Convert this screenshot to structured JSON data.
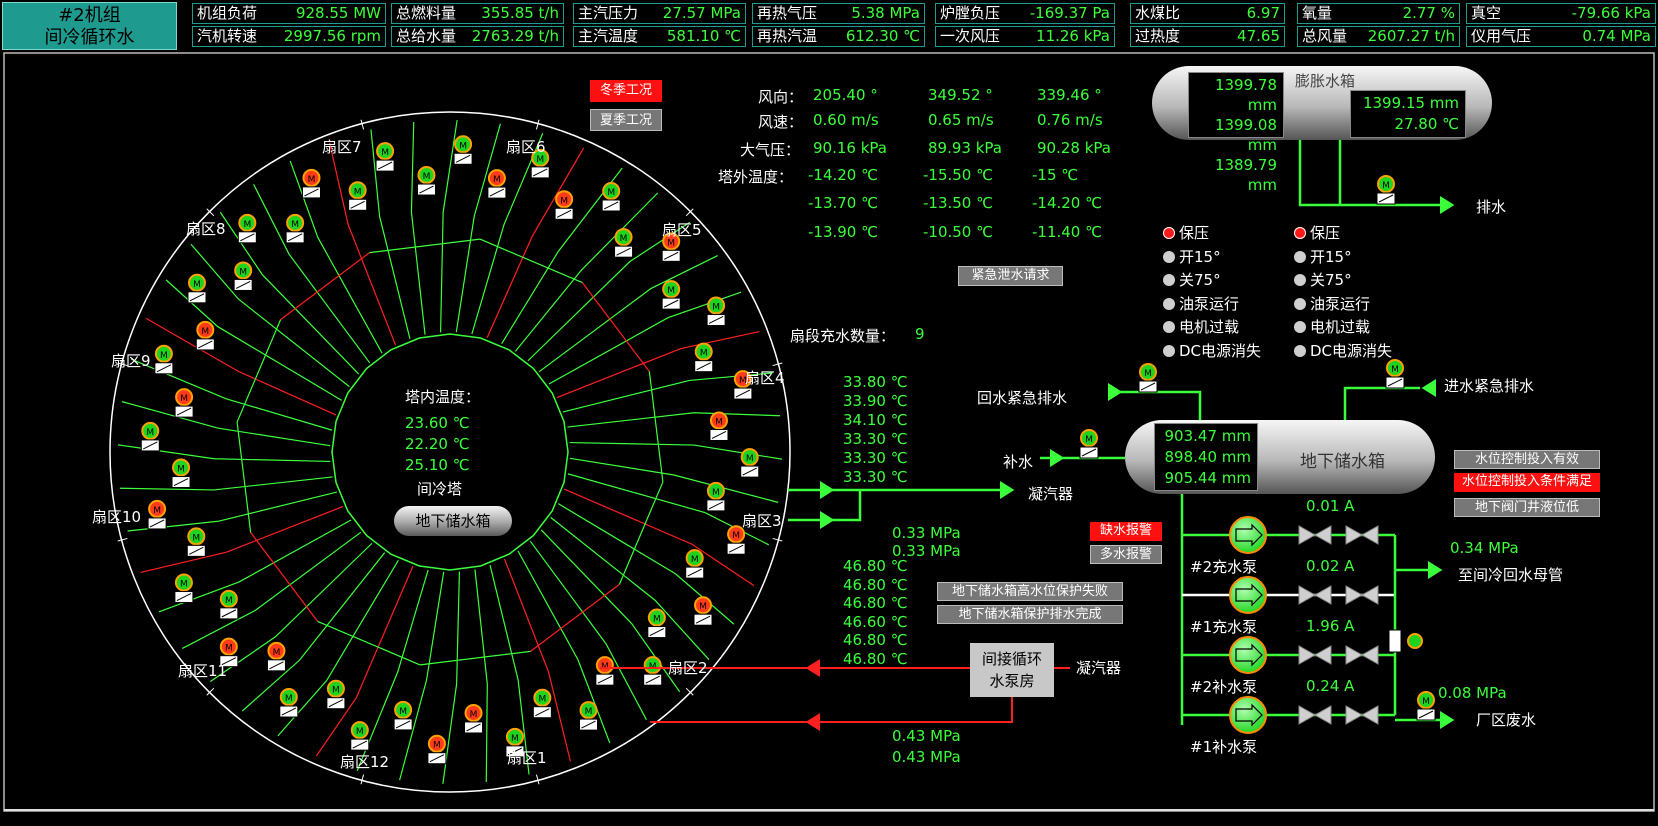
{
  "header": {
    "title_line1": "#2机组",
    "title_line2": "间冷循环水",
    "cells": [
      {
        "label": "机组负荷",
        "value": "928.55 MW"
      },
      {
        "label": "汽机转速",
        "value": "2997.56 rpm"
      },
      {
        "label": "总燃料量",
        "value": "355.85 t/h"
      },
      {
        "label": "总给水量",
        "value": "2763.29 t/h"
      },
      {
        "label": "主汽压力",
        "value": "27.57 MPa"
      },
      {
        "label": "主汽温度",
        "value": "581.10 ℃"
      },
      {
        "label": "再热气压",
        "value": "5.38 MPa"
      },
      {
        "label": "再热汽温",
        "value": "612.30 ℃"
      },
      {
        "label": "炉膛负压",
        "value": "-169.37 Pa"
      },
      {
        "label": "一次风压",
        "value": "11.26 kPa"
      },
      {
        "label": "水煤比",
        "value": "6.97"
      },
      {
        "label": "过热度",
        "value": "47.65"
      },
      {
        "label": "氧量",
        "value": "2.77 %"
      },
      {
        "label": "总风量",
        "value": "2607.27 t/h"
      },
      {
        "label": "真空",
        "value": "-79.66 kPa"
      },
      {
        "label": "仪用气压",
        "value": "0.74 MPa"
      }
    ]
  },
  "mode": {
    "winter": "冬季工况",
    "summer": "夏季工况"
  },
  "weather": {
    "wind_dir_label": "风向：",
    "wind_dir": [
      "205.40 °",
      "349.52 °",
      "339.46 °"
    ],
    "wind_speed_label": "风速：",
    "wind_speed": [
      "0.60 m/s",
      "0.65 m/s",
      "0.76 m/s"
    ],
    "pressure_label": "大气压：",
    "pressure": [
      "90.16 kPa",
      "89.93 kPa",
      "90.28 kPa"
    ],
    "temp_label": "塔外温度：",
    "temp_row1": [
      "-14.20 ℃",
      "-15.50 ℃",
      "-15 ℃"
    ],
    "temp_row2": [
      "-13.70 ℃",
      "-13.50 ℃",
      "-14.20 ℃"
    ],
    "temp_row3": [
      "-13.90 ℃",
      "-10.50 ℃",
      "-11.40 ℃"
    ]
  },
  "tower": {
    "sectors": [
      "扇区1",
      "扇区2",
      "扇区3",
      "扇区4",
      "扇区5",
      "扇区6",
      "扇区7",
      "扇区8",
      "扇区9",
      "扇区10",
      "扇区11",
      "扇区12"
    ],
    "inner_temp_label": "塔内温度：",
    "inner_temps": [
      "23.60 ℃",
      "22.20 ℃",
      "25.10 ℃"
    ],
    "name": "间冷塔",
    "tank": "地下储水箱"
  },
  "emergency_drain": "紧急泄水请求",
  "sector_fill_label": "扇段充水数量：",
  "sector_fill_value": "9",
  "outlet_temps": [
    "33.80 ℃",
    "33.90 ℃",
    "34.10 ℃",
    "33.30 ℃",
    "33.30 ℃",
    "33.30 ℃"
  ],
  "outlet_pressures": [
    "0.33 MPa",
    "0.33 MPa"
  ],
  "return_temps": [
    "46.80 ℃",
    "46.80 ℃",
    "46.80 ℃",
    "46.60 ℃",
    "46.80 ℃",
    "46.80 ℃"
  ],
  "return_pressures": [
    "0.43 MPa",
    "0.43 MPa"
  ],
  "condenser": "凝汽器",
  "pump_house": [
    "间接循环",
    "水泵房"
  ],
  "protect_fail": "地下储水箱高水位保护失败",
  "protect_done": "地下储水箱保护排水完成",
  "alarm_low": "缺水报警",
  "alarm_high": "多水报警",
  "expansion": {
    "name": "膨胀水箱",
    "levels": [
      "1399.78 mm",
      "1399.08 mm",
      "1389.79 mm"
    ],
    "level_right": "1399.15 mm",
    "temp": "27.80 ℃",
    "drain": "排水"
  },
  "status_left": [
    {
      "label": "保压",
      "state": "red"
    },
    {
      "label": "开15°",
      "state": "gray"
    },
    {
      "label": "关75°",
      "state": "gray"
    },
    {
      "label": "油泵运行",
      "state": "gray"
    },
    {
      "label": "电机过载",
      "state": "gray"
    },
    {
      "label": "DC电源消失",
      "state": "gray"
    }
  ],
  "status_right": [
    {
      "label": "保压",
      "state": "red"
    },
    {
      "label": "开15°",
      "state": "gray"
    },
    {
      "label": "关75°",
      "state": "gray"
    },
    {
      "label": "油泵运行",
      "state": "gray"
    },
    {
      "label": "电机过载",
      "state": "gray"
    },
    {
      "label": "DC电源消失",
      "state": "gray"
    }
  ],
  "storage": {
    "name": "地下储水箱",
    "levels": [
      "903.47 mm",
      "898.40 mm",
      "905.44 mm"
    ],
    "return_drain": "回水紧急排水",
    "inlet_drain": "进水紧急排水",
    "makeup": "补水"
  },
  "level_ctrl": {
    "valid": "水位控制投入有效",
    "condition": "水位控制投入条件满足",
    "well_low": "地下阀门井液位低"
  },
  "pumps": [
    {
      "name": "#2充水泵",
      "current": "0.01 A"
    },
    {
      "name": "#1充水泵",
      "current": "0.02 A"
    },
    {
      "name": "#2补水泵",
      "current": "1.96 A"
    },
    {
      "name": "#1补水泵",
      "current": "0.24 A"
    }
  ],
  "header_pressure": "0.34 MPa",
  "to_return_header": "至间冷回水母管",
  "waste_pressure": "0.08 MPa",
  "waste": "厂区废水",
  "colors": {
    "green": "#3cff3c",
    "red": "#ff1a1a",
    "teal": "#1e9a8e"
  }
}
